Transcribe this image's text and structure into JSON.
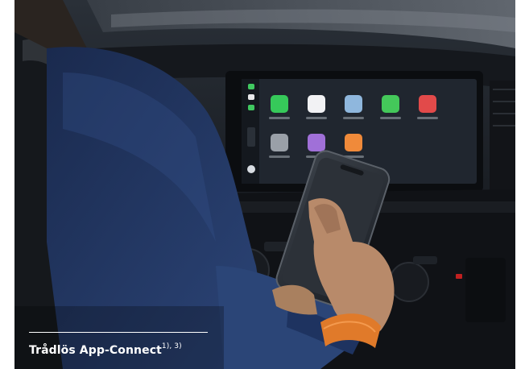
{
  "caption": {
    "title": "Trådlös App-Connect",
    "footnote": "1), 3)"
  },
  "screen": {
    "background": "#20262f",
    "apps_row1": [
      {
        "name": "phone-app-icon",
        "color": "#36c95a"
      },
      {
        "name": "music-app-icon",
        "color": "#f2f2f4"
      },
      {
        "name": "maps-app-icon",
        "color": "#8fb7dd"
      },
      {
        "name": "messages-app-icon",
        "color": "#44c85a"
      },
      {
        "name": "now-playing-app-icon",
        "color": "#e24a4a"
      }
    ],
    "apps_row2": [
      {
        "name": "settings-app-icon",
        "color": "#9aa0a8"
      },
      {
        "name": "podcasts-app-icon",
        "color": "#a070d8"
      },
      {
        "name": "audiobooks-app-icon",
        "color": "#f08a3a"
      }
    ]
  },
  "colors": {
    "jacket": "#243a68",
    "skin": "#b88a6a",
    "bracelet": "#e07a2a",
    "seat": "#1a1d22"
  }
}
